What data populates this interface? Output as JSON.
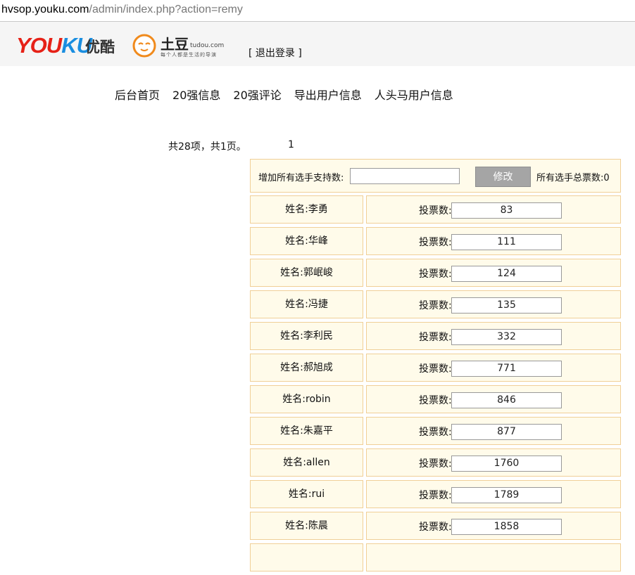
{
  "browser": {
    "url_host": "hvsop.youku.com",
    "url_path": "/admin/index.php?action=remy"
  },
  "header": {
    "youku_part1": "YOU",
    "youku_part2": "KU",
    "youku_cn": "优酷",
    "tudou_cn": "土豆",
    "tudou_en": "tudou.com",
    "tudou_slogan": "每个人都是生活的导演",
    "logout": "[ 退出登录 ]"
  },
  "nav": {
    "items": [
      "后台首页",
      "20强信息",
      "20强评论",
      "导出用户信息",
      "人头马用户信息"
    ]
  },
  "pagination": {
    "summary": "共28项，共1页。",
    "current_page": "1"
  },
  "bulk": {
    "label": "增加所有选手支持数:",
    "input_value": "",
    "button": "修改",
    "total": "所有选手总票数:0"
  },
  "vote_label": "投票数:",
  "candidates": [
    {
      "name": "姓名:李勇",
      "votes": "83"
    },
    {
      "name": "姓名:华峰",
      "votes": "111"
    },
    {
      "name": "姓名:郭岷峻",
      "votes": "124"
    },
    {
      "name": "姓名:冯捷",
      "votes": "135"
    },
    {
      "name": "姓名:李利民",
      "votes": "332"
    },
    {
      "name": "姓名:郝旭成",
      "votes": "771"
    },
    {
      "name": "姓名:robin",
      "votes": "846"
    },
    {
      "name": "姓名:朱嘉平",
      "votes": "877"
    },
    {
      "name": "姓名:allen",
      "votes": "1760"
    },
    {
      "name": "姓名:rui",
      "votes": "1789"
    },
    {
      "name": "姓名:陈晨",
      "votes": "1858"
    }
  ],
  "colors": {
    "cell_border": "#f0cf97",
    "cell_bg": "#fffbea",
    "youku_red": "#e62117",
    "youku_blue": "#1a8ee0",
    "tudou_orange": "#f08a1c"
  }
}
